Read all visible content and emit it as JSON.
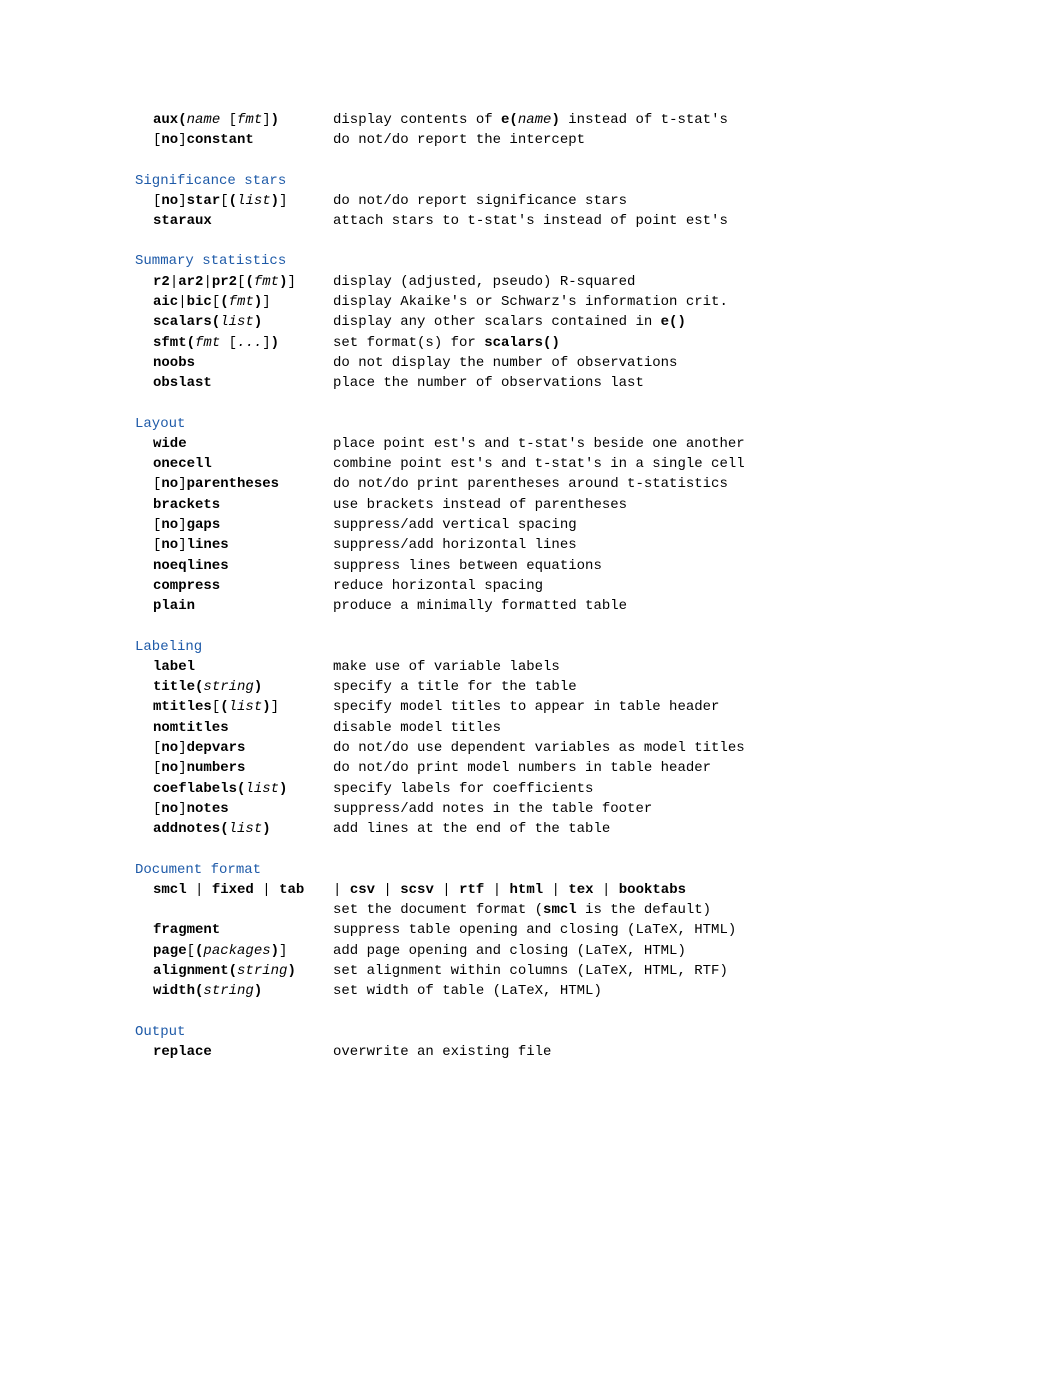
{
  "top": [
    {
      "opt_html": "<b>aux(</b><i>name</i> [<i>fmt</i>]<b>)</b>",
      "desc_html": "display contents of <b>e(</b><i>name</i><b>)</b> instead of t-stat's"
    },
    {
      "opt_html": "[<b>no</b>]<b>constant</b>",
      "desc_html": "do not/do report the intercept"
    }
  ],
  "sections": [
    {
      "title": "Significance stars",
      "rows": [
        {
          "opt_html": "[<b>no</b>]<b>star</b>[<b>(</b><i>list</i><b>)</b>]",
          "desc_html": "do not/do report significance stars"
        },
        {
          "opt_html": "<b>staraux</b>",
          "desc_html": "attach stars to t-stat's instead of point est's"
        }
      ]
    },
    {
      "title": "Summary statistics",
      "rows": [
        {
          "opt_html": "<b>r2</b>|<b>ar2</b>|<b>pr2</b>[<b>(</b><i>fmt</i><b>)</b>]",
          "desc_html": "display (adjusted, pseudo) R-squared"
        },
        {
          "opt_html": "<b>aic</b>|<b>bic</b>[<b>(</b><i>fmt</i><b>)</b>]",
          "desc_html": "display Akaike's or Schwarz's information crit."
        },
        {
          "opt_html": "<b>scalars(</b><i>list</i><b>)</b>",
          "desc_html": "display any other scalars contained in <b>e()</b>"
        },
        {
          "opt_html": "<b>sfmt(</b><i>fmt</i> [<i>...</i>]<b>)</b>",
          "desc_html": "set format(s) for <b>scalars()</b>"
        },
        {
          "opt_html": "<b>noobs</b>",
          "desc_html": "do not display the number of observations"
        },
        {
          "opt_html": "<b>obslast</b>",
          "desc_html": "place the number of observations last"
        }
      ]
    },
    {
      "title": "Layout",
      "rows": [
        {
          "opt_html": "<b>wide</b>",
          "desc_html": "place point est's and t-stat's beside one another"
        },
        {
          "opt_html": "<b>onecell</b>",
          "desc_html": "combine point est's and t-stat's in a single cell"
        },
        {
          "opt_html": "[<b>no</b>]<b>parentheses</b>",
          "desc_html": "do not/do print parentheses around t-statistics"
        },
        {
          "opt_html": "<b>brackets</b>",
          "desc_html": "use brackets instead of parentheses"
        },
        {
          "opt_html": "[<b>no</b>]<b>gaps</b>",
          "desc_html": "suppress/add vertical spacing"
        },
        {
          "opt_html": "[<b>no</b>]<b>lines</b>",
          "desc_html": "suppress/add horizontal lines"
        },
        {
          "opt_html": "<b>noeqlines</b>",
          "desc_html": "suppress lines between equations"
        },
        {
          "opt_html": "<b>compress</b>",
          "desc_html": "reduce horizontal spacing"
        },
        {
          "opt_html": "<b>plain</b>",
          "desc_html": "produce a minimally formatted table"
        }
      ]
    },
    {
      "title": "Labeling",
      "rows": [
        {
          "opt_html": "<b>label</b>",
          "desc_html": "make use of variable labels"
        },
        {
          "opt_html": "<b>title(</b><i>string</i><b>)</b>",
          "desc_html": "specify a title for the table"
        },
        {
          "opt_html": "<b>mtitles</b>[<b>(</b><i>list</i><b>)</b>]",
          "desc_html": "specify model titles to appear in table header"
        },
        {
          "opt_html": "<b>nomtitles</b>",
          "desc_html": "disable model titles"
        },
        {
          "opt_html": "[<b>no</b>]<b>depvars</b>",
          "desc_html": "do not/do use dependent variables as model titles"
        },
        {
          "opt_html": "[<b>no</b>]<b>numbers</b>",
          "desc_html": "do not/do print model numbers in table header"
        },
        {
          "opt_html": "<b>coeflabels(</b><i>list</i><b>)</b>",
          "desc_html": "specify labels for coefficients"
        },
        {
          "opt_html": "[<b>no</b>]<b>notes</b>",
          "desc_html": "suppress/add notes in the table footer"
        },
        {
          "opt_html": "<b>addnotes(</b><i>list</i><b>)</b>",
          "desc_html": "add lines at the end of the table"
        }
      ]
    },
    {
      "title": "Document format",
      "rows": [
        {
          "opt_html": "<b>smcl</b> | <b>fixed</b> | <b>tab</b>",
          "desc_html": "| <b>csv</b> | <b>scsv</b> | <b>rtf</b> | <b>html</b> | <b>tex</b> | <b>booktabs</b>",
          "joined": true
        },
        {
          "opt_html": "",
          "desc_html": "set the document format (<b>smcl</b> is the default)"
        },
        {
          "opt_html": "<b>fragment</b>",
          "desc_html": "suppress table opening and closing (LaTeX, HTML)"
        },
        {
          "opt_html": "<b>page</b>[<b>(</b><i>packages</i><b>)</b>]",
          "desc_html": "add page opening and closing (LaTeX, HTML)"
        },
        {
          "opt_html": "<b>alignment(</b><i>string</i><b>)</b>",
          "desc_html": "set alignment within columns (LaTeX, HTML, RTF)"
        },
        {
          "opt_html": "<b>width(</b><i>string</i><b>)</b>",
          "desc_html": "set width of table (LaTeX, HTML)"
        }
      ]
    },
    {
      "title": "Output",
      "rows": [
        {
          "opt_html": "<b>replace</b>",
          "desc_html": "overwrite an existing file"
        }
      ]
    }
  ]
}
